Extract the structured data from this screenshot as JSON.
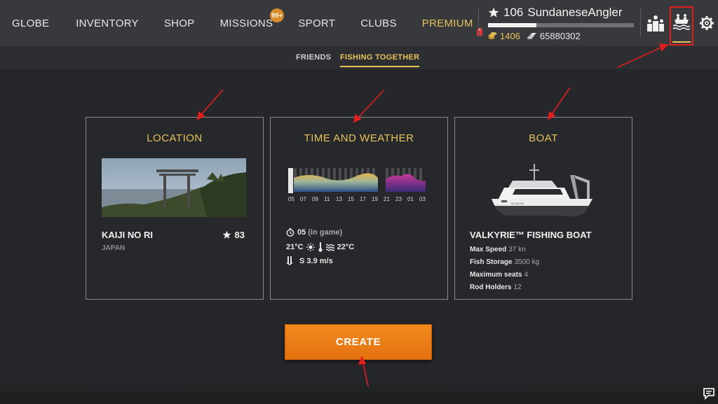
{
  "nav": {
    "globe": "GLOBE",
    "inventory": "INVENTORY",
    "shop": "SHOP",
    "missions": "MISSIONS",
    "missions_badge": "99+",
    "sport": "SPORT",
    "clubs": "CLUBS",
    "premium": "PREMIUM"
  },
  "player": {
    "level": "106",
    "name": "SundaneseAngler",
    "xp_progress": 0.33,
    "gold": "1406",
    "silver": "65880302"
  },
  "header_icons": [
    "ranks-icon",
    "fishing-together-icon",
    "gear-icon"
  ],
  "subtabs": {
    "friends": "FRIENDS",
    "fishing_together": "FISHING TOGETHER"
  },
  "location": {
    "title": "LOCATION",
    "name": "KAIJI NO RI",
    "country": "JAPAN",
    "rating": "83"
  },
  "time_weather": {
    "title": "TIME AND WEATHER",
    "hours": [
      "05",
      "07",
      "09",
      "11",
      "13",
      "15",
      "17",
      "19",
      "21",
      "23",
      "01",
      "03"
    ],
    "time": "05",
    "time_note": "(in game)",
    "air_temp": "21°C",
    "water_temp": "22°C",
    "wind": "S 3.9 m/s"
  },
  "boat": {
    "title": "BOAT",
    "name": "VALKYRIE™ FISHING BOAT",
    "hull_text": "W-169-PA",
    "specs": [
      {
        "label": "Max Speed",
        "value": "37 kn"
      },
      {
        "label": "Fish Storage",
        "value": "3500 kg"
      },
      {
        "label": "Maximum seats",
        "value": "4"
      },
      {
        "label": "Rod Holders",
        "value": "12"
      }
    ]
  },
  "create_label": "CREATE",
  "colors": {
    "accent": "#e6c35a",
    "button": "#ee8419",
    "annotation": "#e01e1e"
  }
}
